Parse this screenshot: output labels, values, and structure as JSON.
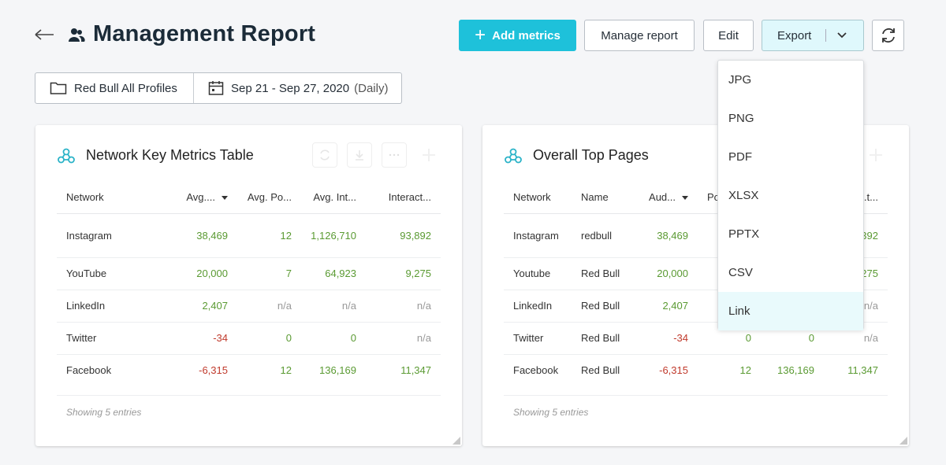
{
  "header": {
    "title": "Management Report",
    "buttons": {
      "add_metrics": "Add metrics",
      "manage_report": "Manage report",
      "edit": "Edit",
      "export": "Export"
    }
  },
  "filters": {
    "profile": "Red Bull All Profiles",
    "date_range": "Sep 21 - Sep 27, 2020",
    "granularity": "(Daily)"
  },
  "export_menu": {
    "items": [
      "JPG",
      "PNG",
      "PDF",
      "XLSX",
      "PPTX",
      "CSV",
      "Link"
    ],
    "highlighted": "Link"
  },
  "cards": [
    {
      "title": "Network Key Metrics Table",
      "columns": [
        "Network",
        "Avg....",
        "Avg. Po...",
        "Avg. Int...",
        "Interact..."
      ],
      "sorted_column": "Avg....",
      "rows": [
        {
          "network": "Instagram",
          "c1": "38,469",
          "c2": "12",
          "c3": "1,126,710",
          "c4": "93,892"
        },
        {
          "network": "YouTube",
          "c1": "20,000",
          "c2": "7",
          "c3": "64,923",
          "c4": "9,275"
        },
        {
          "network": "LinkedIn",
          "c1": "2,407",
          "c2": "n/a",
          "c3": "n/a",
          "c4": "n/a"
        },
        {
          "network": "Twitter",
          "c1": "-34",
          "c2": "0",
          "c3": "0",
          "c4": "n/a"
        },
        {
          "network": "Facebook",
          "c1": "-6,315",
          "c2": "12",
          "c3": "136,169",
          "c4": "11,347"
        }
      ],
      "footer": "Showing 5 entries"
    },
    {
      "title": "Overall Top Pages",
      "columns": [
        "Network",
        "Name",
        "Aud...",
        "Po...",
        "",
        "...t..."
      ],
      "sorted_column": "Aud...",
      "rows": [
        {
          "network": "Instagram",
          "name": "redbull",
          "c1": "38,469",
          "c2": "",
          "c3": "",
          "c4": "392"
        },
        {
          "network": "Youtube",
          "name": "Red Bull",
          "c1": "20,000",
          "c2": "",
          "c3": "",
          "c4": "275"
        },
        {
          "network": "LinkedIn",
          "name": "Red Bull",
          "c1": "2,407",
          "c2": "",
          "c3": "",
          "c4": "n/a"
        },
        {
          "network": "Twitter",
          "name": "Red Bull",
          "c1": "-34",
          "c2": "0",
          "c3": "0",
          "c4": "n/a"
        },
        {
          "network": "Facebook",
          "name": "Red Bull",
          "c1": "-6,315",
          "c2": "12",
          "c3": "136,169",
          "c4": "11,347"
        }
      ],
      "footer": "Showing 5 entries"
    }
  ],
  "colors": {
    "accent": "#1ec1da",
    "positive": "#5a9a32",
    "negative": "#c0392b",
    "export_bg": "#dff8fc"
  }
}
